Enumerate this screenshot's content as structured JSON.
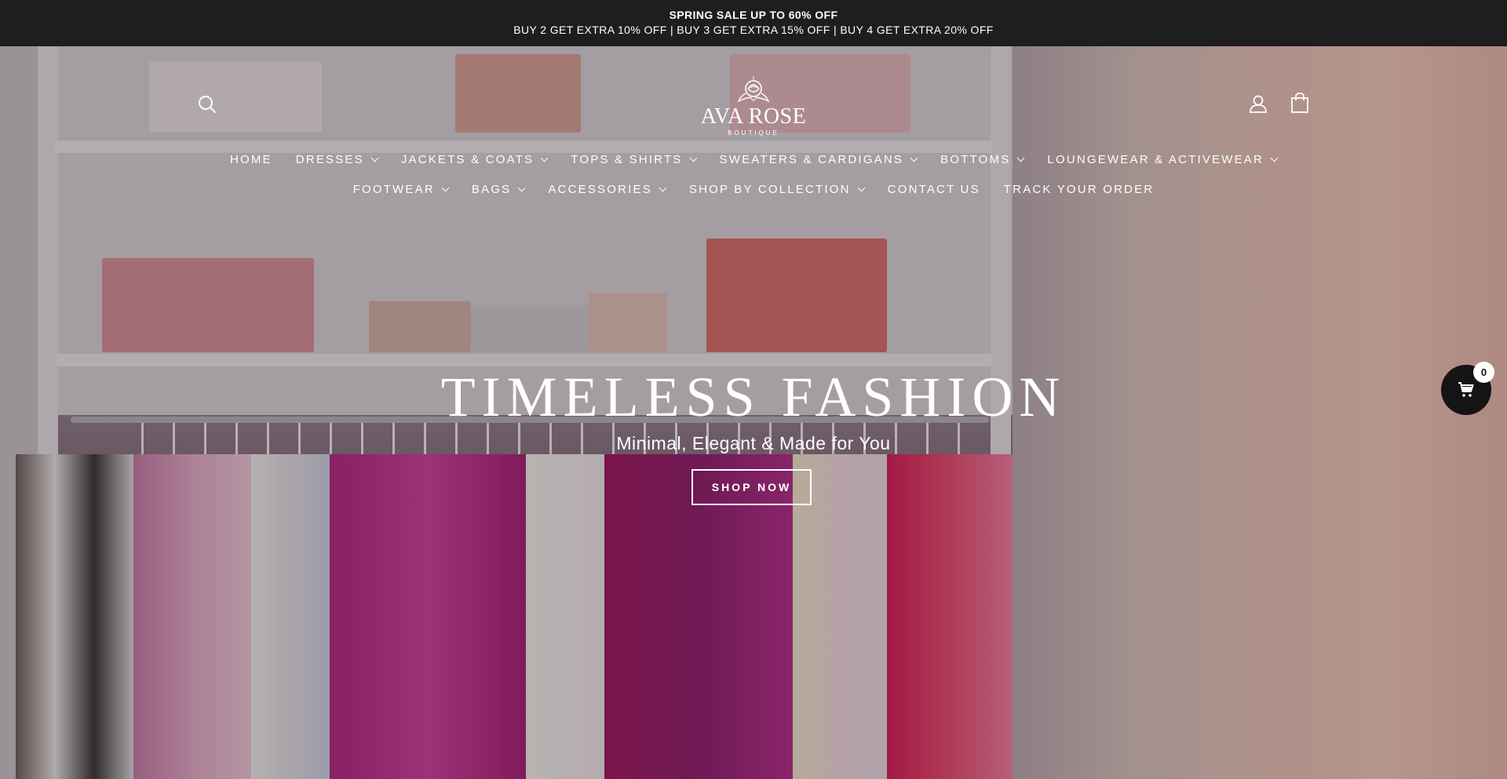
{
  "announcement": {
    "line1": "SPRING SALE UP TO 60% OFF",
    "line2": "BUY 2 GET EXTRA 10% OFF | BUY 3 GET EXTRA 15% OFF | BUY 4 GET EXTRA 20% OFF"
  },
  "header": {
    "logo_name": "AVA ROSE",
    "logo_sub": "BOUTIQUE",
    "icons": [
      "search-icon",
      "account-icon",
      "bag-icon"
    ]
  },
  "nav": {
    "row1": [
      {
        "label": "HOME",
        "dropdown": false
      },
      {
        "label": "DRESSES",
        "dropdown": true
      },
      {
        "label": "JACKETS & COATS",
        "dropdown": true
      },
      {
        "label": "TOPS & SHIRTS",
        "dropdown": true
      },
      {
        "label": "SWEATERS & CARDIGANS",
        "dropdown": true
      },
      {
        "label": "BOTTOMS",
        "dropdown": true
      },
      {
        "label": "LOUNGEWEAR & ACTIVEWEAR",
        "dropdown": true
      }
    ],
    "row2": [
      {
        "label": "FOOTWEAR",
        "dropdown": true
      },
      {
        "label": "BAGS",
        "dropdown": true
      },
      {
        "label": "ACCESSORIES",
        "dropdown": true
      },
      {
        "label": "SHOP BY COLLECTION",
        "dropdown": true
      },
      {
        "label": "CONTACT US",
        "dropdown": false
      },
      {
        "label": "TRACK YOUR ORDER",
        "dropdown": false
      }
    ]
  },
  "hero": {
    "title": "TIMELESS FASHION",
    "subtitle": "Minimal, Elegant & Made for You",
    "cta": "SHOP NOW"
  },
  "floating_cart": {
    "count": "0",
    "icon": "cart-icon"
  },
  "colors": {
    "announcement_bg": "#1e1e1e",
    "text": "#ffffff"
  }
}
